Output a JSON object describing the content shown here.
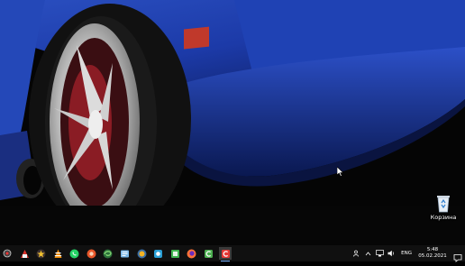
{
  "desktop": {
    "icons": [
      {
        "label": "Корзина",
        "icon": "recycle-bin-icon"
      }
    ]
  },
  "taskbar": {
    "apps": [
      {
        "icon": "start-icon",
        "color": "#cfcfcf"
      },
      {
        "icon": "app-red-icon",
        "color": "#d9322b"
      },
      {
        "icon": "app-star-icon",
        "color": "#f2c230"
      },
      {
        "icon": "vlc-icon",
        "color": "#f08a00"
      },
      {
        "icon": "whatsapp-icon",
        "color": "#25d366"
      },
      {
        "icon": "app-orange-icon",
        "color": "#e8572a"
      },
      {
        "icon": "app-green-swirl-icon",
        "color": "#7fcf6f"
      },
      {
        "icon": "app-blue-icon",
        "color": "#7ab8e8"
      },
      {
        "icon": "app-yellow-icon",
        "color": "#f4b323"
      },
      {
        "icon": "app-teal-icon",
        "color": "#2a9fd6"
      },
      {
        "icon": "app-green-icon",
        "color": "#3fb34f"
      },
      {
        "icon": "firefox-icon",
        "color": "#ff7139"
      },
      {
        "icon": "app-green-c-icon",
        "color": "#4caf50"
      },
      {
        "icon": "app-red-c-icon",
        "color": "#e53935"
      }
    ],
    "active_index": 13,
    "tray": {
      "language": "ENG",
      "time": "5:48",
      "date": "05.02.2021"
    }
  }
}
